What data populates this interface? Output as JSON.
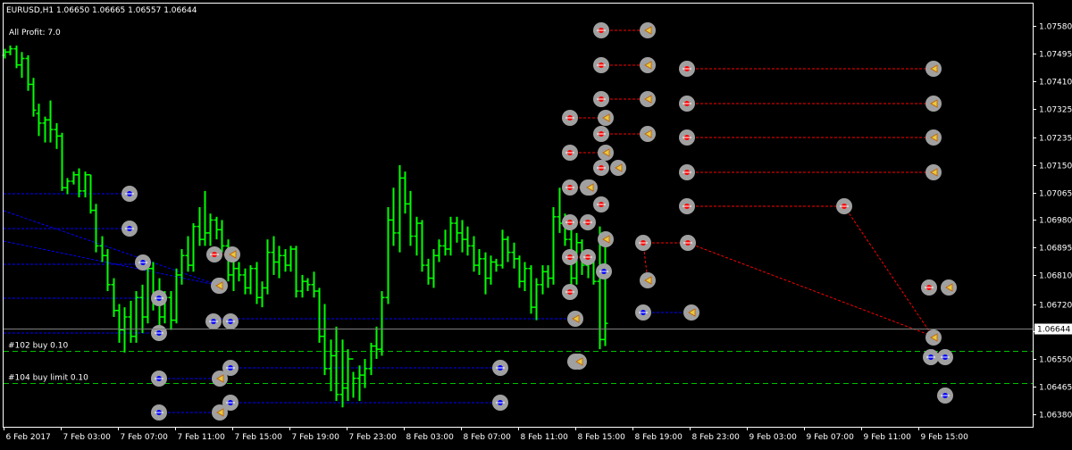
{
  "header": {
    "symbol_line": "EURUSD,H1  1.06650 1.06665 1.06557 1.06644",
    "profit_line": "All Profit: 7.0"
  },
  "orders": {
    "order_102": "#102 buy 0.10",
    "order_104": "#104 buy limit 0.10"
  },
  "colors": {
    "background": "#000000",
    "frame": "#ffffff",
    "candle": "#00ff00",
    "buy_line": "#0000ff",
    "sell_line": "#ff0000",
    "order_line": "#00c000",
    "marker_ring": "#a0a0a0"
  },
  "chart_data": {
    "type": "candlestick",
    "symbol": "EURUSD",
    "timeframe": "H1",
    "last_price": 1.06644,
    "last_price_label": "1.06644",
    "ylim": [
      1.0634,
      1.0765
    ],
    "y_ticks": [
      1.0758,
      1.07495,
      1.0741,
      1.07325,
      1.07235,
      1.0715,
      1.07065,
      1.0698,
      1.06895,
      1.0681,
      1.0672,
      1.06635,
      1.0655,
      1.06465,
      1.0638
    ],
    "y_tick_labels": [
      "1.07580",
      "1.07495",
      "1.07410",
      "1.07325",
      "1.07235",
      "1.07150",
      "1.07065",
      "1.06980",
      "1.06895",
      "1.06810",
      "1.06720",
      "1.06635",
      "1.06550",
      "1.06465",
      "1.06380"
    ],
    "x_tick_labels": [
      "6 Feb 2017",
      "7 Feb 03:00",
      "7 Feb 07:00",
      "7 Feb 11:00",
      "7 Feb 15:00",
      "7 Feb 19:00",
      "7 Feb 23:00",
      "8 Feb 03:00",
      "8 Feb 07:00",
      "8 Feb 11:00",
      "8 Feb 15:00",
      "8 Feb 19:00",
      "8 Feb 23:00",
      "9 Feb 03:00",
      "9 Feb 07:00",
      "9 Feb 11:00",
      "9 Feb 15:00"
    ],
    "order_levels": [
      {
        "label_key": "order_102",
        "price": 1.06575
      },
      {
        "label_key": "order_104",
        "price": 1.06475
      }
    ],
    "candles": [
      [
        1.0749,
        1.0751,
        1.0748,
        1.075
      ],
      [
        1.075,
        1.0752,
        1.0749,
        1.0751
      ],
      [
        1.0751,
        1.0752,
        1.0745,
        1.0746
      ],
      [
        1.0746,
        1.075,
        1.0742,
        1.0748
      ],
      [
        1.0748,
        1.0749,
        1.0738,
        1.074
      ],
      [
        1.074,
        1.0742,
        1.073,
        1.0732
      ],
      [
        1.0731,
        1.0734,
        1.0724,
        1.0728
      ],
      [
        1.0728,
        1.073,
        1.0722,
        1.0729
      ],
      [
        1.0729,
        1.0735,
        1.0722,
        1.0726
      ],
      [
        1.0726,
        1.0728,
        1.072,
        1.0724
      ],
      [
        1.0724,
        1.0725,
        1.0707,
        1.0708
      ],
      [
        1.0708,
        1.0711,
        1.0706,
        1.071
      ],
      [
        1.071,
        1.0713,
        1.0709,
        1.0712
      ],
      [
        1.0712,
        1.0714,
        1.0705,
        1.0707
      ],
      [
        1.0707,
        1.0713,
        1.0705,
        1.0712
      ],
      [
        1.0712,
        1.0712,
        1.07,
        1.0701
      ],
      [
        1.0701,
        1.0703,
        1.0688,
        1.069
      ],
      [
        1.069,
        1.0693,
        1.0685,
        1.0687
      ],
      [
        1.0687,
        1.0689,
        1.0676,
        1.0678
      ],
      [
        1.0678,
        1.068,
        1.0668,
        1.067
      ],
      [
        1.067,
        1.0672,
        1.066,
        1.0664
      ],
      [
        1.0664,
        1.0671,
        1.0657,
        1.0668
      ],
      [
        1.0668,
        1.0673,
        1.066,
        1.0662
      ],
      [
        1.0662,
        1.0676,
        1.066,
        1.0674
      ],
      [
        1.0674,
        1.0678,
        1.0663,
        1.0668
      ],
      [
        1.0668,
        1.0685,
        1.0666,
        1.0683
      ],
      [
        1.0683,
        1.0685,
        1.067,
        1.0673
      ],
      [
        1.0673,
        1.068,
        1.0665,
        1.0668
      ],
      [
        1.0668,
        1.0676,
        1.0666,
        1.0674
      ],
      [
        1.0674,
        1.0676,
        1.0664,
        1.0667
      ],
      [
        1.0667,
        1.0683,
        1.0666,
        1.0681
      ],
      [
        1.0681,
        1.0689,
        1.0678,
        1.0687
      ],
      [
        1.0687,
        1.0693,
        1.0682,
        1.0684
      ],
      [
        1.0684,
        1.0697,
        1.0682,
        1.0696
      ],
      [
        1.0696,
        1.0702,
        1.069,
        1.0692
      ],
      [
        1.0692,
        1.0707,
        1.069,
        1.0694
      ],
      [
        1.0694,
        1.07,
        1.069,
        1.0698
      ],
      [
        1.0698,
        1.0699,
        1.0692,
        1.0695
      ],
      [
        1.0695,
        1.0698,
        1.0688,
        1.069
      ],
      [
        1.069,
        1.0692,
        1.0679,
        1.0681
      ],
      [
        1.0681,
        1.0686,
        1.0676,
        1.0683
      ],
      [
        1.0683,
        1.0685,
        1.0679,
        1.0681
      ],
      [
        1.0681,
        1.0683,
        1.0675,
        1.0677
      ],
      [
        1.0677,
        1.0684,
        1.0675,
        1.0683
      ],
      [
        1.0683,
        1.0685,
        1.0672,
        1.0674
      ],
      [
        1.0674,
        1.0679,
        1.0671,
        1.0677
      ],
      [
        1.0677,
        1.0692,
        1.0675,
        1.0688
      ],
      [
        1.0688,
        1.0693,
        1.0681,
        1.0685
      ],
      [
        1.0685,
        1.069,
        1.068,
        1.0687
      ],
      [
        1.0687,
        1.0689,
        1.0682,
        1.0684
      ],
      [
        1.0684,
        1.069,
        1.0682,
        1.0689
      ],
      [
        1.0689,
        1.069,
        1.0674,
        1.0676
      ],
      [
        1.0676,
        1.0681,
        1.0674,
        1.0679
      ],
      [
        1.0679,
        1.068,
        1.0676,
        1.0678
      ],
      [
        1.0678,
        1.0682,
        1.0674,
        1.0676
      ],
      [
        1.0676,
        1.0677,
        1.066,
        1.0662
      ],
      [
        1.0662,
        1.0672,
        1.065,
        1.0652
      ],
      [
        1.0652,
        1.0661,
        1.0645,
        1.0656
      ],
      [
        1.0656,
        1.0665,
        1.0642,
        1.0644
      ],
      [
        1.0644,
        1.0661,
        1.064,
        1.0646
      ],
      [
        1.0646,
        1.0658,
        1.0642,
        1.0655
      ],
      [
        1.0655,
        1.0651,
        1.0643,
        1.0649
      ],
      [
        1.0649,
        1.0653,
        1.0642,
        1.065
      ],
      [
        1.065,
        1.0655,
        1.0646,
        1.0652
      ],
      [
        1.0652,
        1.066,
        1.065,
        1.0659
      ],
      [
        1.0659,
        1.0665,
        1.0655,
        1.0658
      ],
      [
        1.0658,
        1.0676,
        1.0656,
        1.0674
      ],
      [
        1.0674,
        1.0702,
        1.0672,
        1.0698
      ],
      [
        1.0698,
        1.0708,
        1.069,
        1.0694
      ],
      [
        1.0694,
        1.0715,
        1.0688,
        1.0711
      ],
      [
        1.0711,
        1.0713,
        1.07,
        1.0703
      ],
      [
        1.0703,
        1.0707,
        1.069,
        1.0693
      ],
      [
        1.0693,
        1.0699,
        1.0687,
        1.0697
      ],
      [
        1.0697,
        1.0698,
        1.0682,
        1.0684
      ],
      [
        1.0684,
        1.0686,
        1.0678,
        1.068
      ],
      [
        1.068,
        1.0689,
        1.0677,
        1.0687
      ],
      [
        1.0687,
        1.0692,
        1.0685,
        1.069
      ],
      [
        1.069,
        1.0695,
        1.0687,
        1.0689
      ],
      [
        1.0689,
        1.0699,
        1.0687,
        1.0697
      ],
      [
        1.0697,
        1.0699,
        1.0691,
        1.0694
      ],
      [
        1.0694,
        1.0698,
        1.0688,
        1.0692
      ],
      [
        1.0692,
        1.0696,
        1.0687,
        1.069
      ],
      [
        1.069,
        1.0693,
        1.0682,
        1.0684
      ],
      [
        1.0684,
        1.0689,
        1.0681,
        1.0686
      ],
      [
        1.0686,
        1.0688,
        1.0675,
        1.068
      ],
      [
        1.068,
        1.0687,
        1.0678,
        1.0685
      ],
      [
        1.0685,
        1.0686,
        1.0682,
        1.0684
      ],
      [
        1.0684,
        1.0695,
        1.0683,
        1.0692
      ],
      [
        1.0692,
        1.0693,
        1.0685,
        1.0688
      ],
      [
        1.0688,
        1.0691,
        1.0683,
        1.0686
      ],
      [
        1.0686,
        1.0687,
        1.0677,
        1.0679
      ],
      [
        1.0679,
        1.0685,
        1.0676,
        1.0683
      ],
      [
        1.0683,
        1.0684,
        1.0669,
        1.0671
      ],
      [
        1.0671,
        1.068,
        1.0667,
        1.0678
      ],
      [
        1.0678,
        1.0684,
        1.0675,
        1.0682
      ],
      [
        1.0682,
        1.0684,
        1.0677,
        1.068
      ],
      [
        1.068,
        1.0702,
        1.0678,
        1.0699
      ],
      [
        1.0699,
        1.0708,
        1.0694,
        1.0697
      ],
      [
        1.0697,
        1.07,
        1.069,
        1.0692
      ],
      [
        1.0692,
        1.0698,
        1.0676,
        1.068
      ],
      [
        1.068,
        1.0694,
        1.0678,
        1.0691
      ],
      [
        1.0691,
        1.0692,
        1.0681,
        1.0684
      ],
      [
        1.0684,
        1.0689,
        1.068,
        1.0686
      ],
      [
        1.0686,
        1.0687,
        1.0678,
        1.0679
      ],
      [
        1.0679,
        1.0696,
        1.0658,
        1.0661
      ],
      [
        1.0661,
        1.0693,
        1.0659,
        1.0666
      ]
    ]
  }
}
